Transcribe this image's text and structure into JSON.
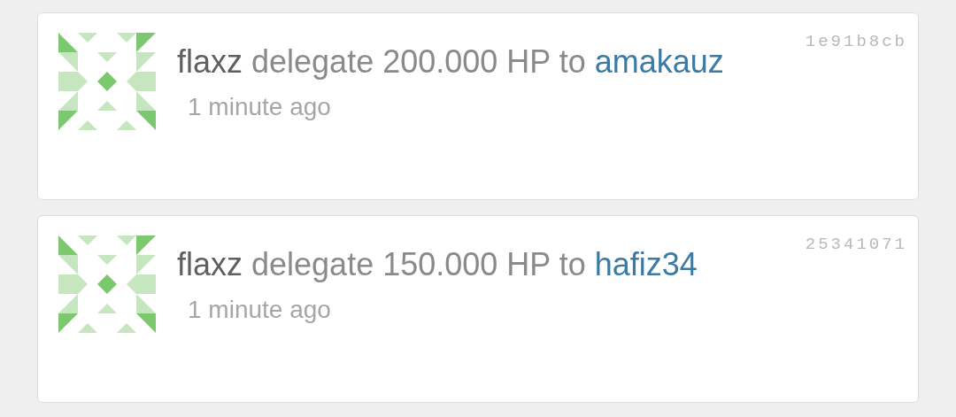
{
  "activities": [
    {
      "actor": "flaxz",
      "action": "delegate 200.000 HP to",
      "target": "amakauz",
      "time": "1 minute ago",
      "hash": "1e91b8cb"
    },
    {
      "actor": "flaxz",
      "action": "delegate 150.000 HP to",
      "target": "hafiz34",
      "time": "1 minute ago",
      "hash": "25341071"
    }
  ]
}
